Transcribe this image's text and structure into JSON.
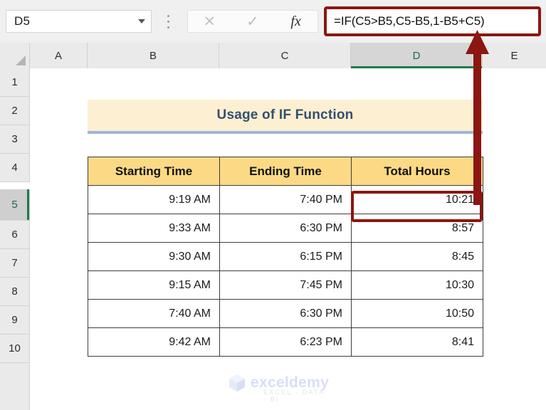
{
  "formula_bar": {
    "name_box_value": "D5",
    "name_box_dropdown": "chevron-down-icon",
    "cancel_label": "✕",
    "enter_label": "✓",
    "fx_label": "fx",
    "formula_value": "=IF(C5>B5,C5-B5,1-B5+C5)"
  },
  "grid": {
    "columns": [
      "A",
      "B",
      "C",
      "D",
      "E"
    ],
    "selected_column": "D",
    "rows": [
      "1",
      "2",
      "3",
      "4",
      "5",
      "6",
      "7",
      "8",
      "9",
      "10"
    ],
    "selected_row": "5"
  },
  "sheet": {
    "title": "Usage of IF Function",
    "table": {
      "headers": [
        "Starting Time",
        "Ending Time",
        "Total Hours"
      ],
      "rows": [
        {
          "starting_time": "9:19 AM",
          "ending_time": "7:40 PM",
          "total_hours": "10:21"
        },
        {
          "starting_time": "9:33 AM",
          "ending_time": "6:30 PM",
          "total_hours": "8:57"
        },
        {
          "starting_time": "9:30 AM",
          "ending_time": "6:15 PM",
          "total_hours": "8:45"
        },
        {
          "starting_time": "9:15 AM",
          "ending_time": "7:45 PM",
          "total_hours": "10:30"
        },
        {
          "starting_time": "7:40 AM",
          "ending_time": "6:30 PM",
          "total_hours": "10:50"
        },
        {
          "starting_time": "9:42 AM",
          "ending_time": "6:23 PM",
          "total_hours": "8:41"
        }
      ]
    }
  },
  "annotation": {
    "highlight_color": "#8a1711",
    "arrow_name": "callout-arrow-d5-to-formula-bar"
  },
  "watermark": {
    "brand": "exceldemy",
    "tagline": "EXCEL · DATA · BI"
  },
  "colors": {
    "header_fill": "#fcd984",
    "title_fill": "#fcefd2",
    "title_text": "#33506e",
    "title_underline": "#9fb5d9",
    "selection_green": "#207a48"
  }
}
